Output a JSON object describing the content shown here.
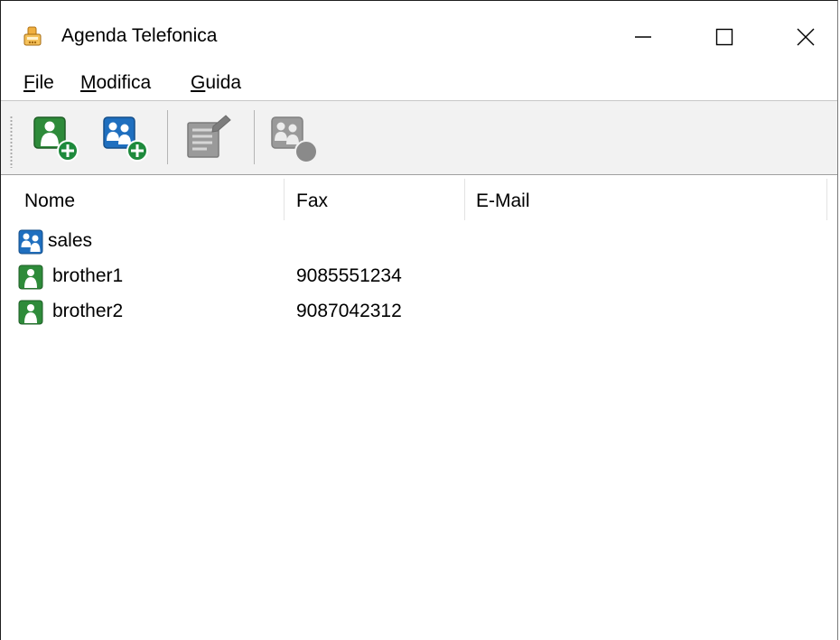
{
  "window": {
    "title": "Agenda Telefonica",
    "app_icon": "phonebook-icon",
    "controls": {
      "minimize": "minimize-icon",
      "maximize": "maximize-icon",
      "close": "close-icon"
    }
  },
  "menu": {
    "items": [
      {
        "label_mnemonic": "F",
        "label_rest": "ile"
      },
      {
        "label_mnemonic": "M",
        "label_rest": "odifica"
      },
      {
        "label_mnemonic": "G",
        "label_rest": "uida"
      }
    ]
  },
  "toolbar": {
    "buttons": [
      {
        "icon": "add-contact-icon",
        "enabled": true
      },
      {
        "icon": "add-group-icon",
        "enabled": true
      },
      {
        "icon": "edit-icon",
        "enabled": false
      },
      {
        "icon": "delete-icon",
        "enabled": false
      }
    ]
  },
  "list": {
    "columns": [
      "Nome",
      "Fax",
      "E-Mail"
    ],
    "rows": [
      {
        "type": "group",
        "icon": "group-icon",
        "name": "sales",
        "fax": "",
        "email": ""
      },
      {
        "type": "contact",
        "icon": "contact-icon",
        "name": "brother1",
        "fax": "9085551234",
        "email": ""
      },
      {
        "type": "contact",
        "icon": "contact-icon",
        "name": "brother2",
        "fax": "9087042312",
        "email": ""
      }
    ]
  },
  "colors": {
    "contact_green": "#2e8b3a",
    "group_blue": "#1f6fbf",
    "toolbar_bg": "#f2f2f2",
    "disabled_gray": "#8a8a8a"
  }
}
